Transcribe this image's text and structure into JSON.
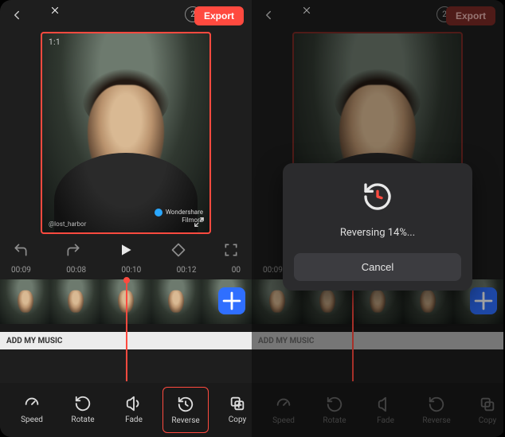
{
  "header": {
    "export_label": "Export",
    "badge_value": "2",
    "aspect_label": "1:1"
  },
  "watermark": {
    "brand_top": "Wondershare",
    "brand_bottom": "Filmora",
    "handle": "@lost_harbor"
  },
  "controls": {
    "times": [
      "00:09",
      "00:08",
      "00:10",
      "00:12",
      "00"
    ]
  },
  "timeline": {
    "music_label": "ADD MY MUSIC"
  },
  "tools": {
    "speed": "Speed",
    "rotate": "Rotate",
    "fade": "Fade",
    "reverse": "Reverse",
    "copy": "Copy"
  },
  "progress": {
    "title": "Reversing 14%...",
    "cancel": "Cancel"
  }
}
